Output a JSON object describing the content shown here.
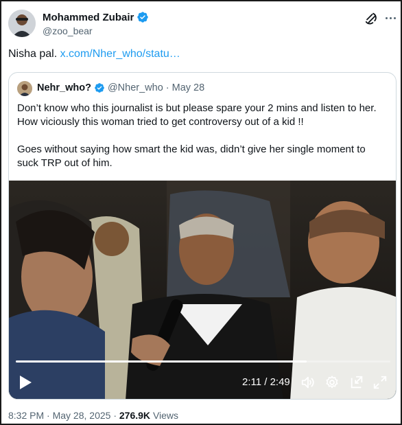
{
  "author": {
    "display_name": "Mohammed Zubair",
    "handle": "@zoo_bear",
    "verified_icon": "verified-badge-icon"
  },
  "tweet": {
    "text_prefix": "Nisha pal.",
    "link_text": "x.com/Nher_who/statu…"
  },
  "quoted": {
    "display_name": "Nehr_who?",
    "handle": "@Nher_who",
    "separator": "·",
    "date": "May 28",
    "paragraph_1": "Don’t know who this journalist is but please spare your 2 mins and listen to her. How viciously this woman tried to get controversy out of a kid !!",
    "paragraph_2": "Goes without saying how smart the kid was, didn’t give her single moment to suck TRP out of him."
  },
  "video": {
    "time_display": "2:11 / 2:49",
    "progress_fraction": 0.776
  },
  "footer": {
    "time": "8:32 PM",
    "sep1": "·",
    "date": "May 28, 2025",
    "sep2": "·",
    "views_count": "276.9K",
    "views_label": "Views"
  },
  "colors": {
    "link": "#1d9bf0",
    "verified": "#1d9bf0",
    "muted": "#536471",
    "text": "#0f1419"
  }
}
